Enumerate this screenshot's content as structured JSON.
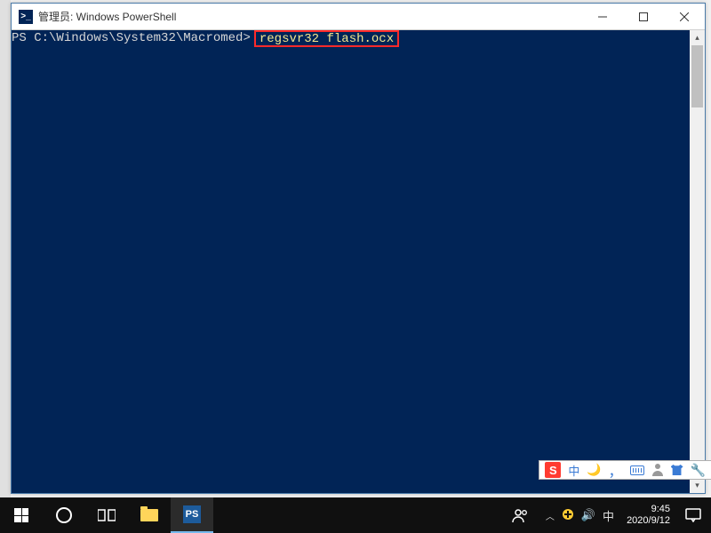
{
  "window": {
    "title": "管理员: Windows PowerShell",
    "icon_glyph": ">_"
  },
  "console": {
    "prompt_prefix": "PS ",
    "path": "C:\\Windows\\System32\\Macromed",
    "prompt_suffix": ">",
    "command": "regsvr32 flash.ocx"
  },
  "ime": {
    "logo": "S",
    "lang": "中",
    "moon": "🌙",
    "punct": "，",
    "keyboard": "kbd",
    "user": "user",
    "skin": "skin",
    "settings": "🔧"
  },
  "taskbar": {
    "start": "start",
    "search": "search",
    "taskview": "taskview",
    "explorer": "explorer",
    "powershell": "PS"
  },
  "tray": {
    "people": "people",
    "chevron": "︿",
    "defender_color": "#ffcc33",
    "volume": "🔊",
    "ime_lang": "中",
    "time": "9:45",
    "date": "2020/9/12",
    "notifications": "notif"
  }
}
